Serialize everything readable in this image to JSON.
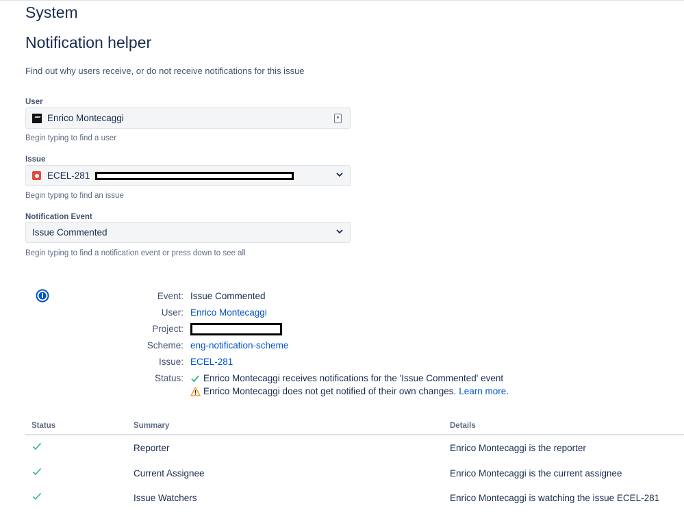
{
  "header": {
    "section_title": "System",
    "page_title": "Notification helper",
    "description": "Find out why users receive, or do not receive notifications for this issue"
  },
  "form": {
    "user": {
      "label": "User",
      "value": "Enrico Montecaggi",
      "hint": "Begin typing to find a user",
      "icon": "user-avatar"
    },
    "issue": {
      "label": "Issue",
      "value": "ECEL-281",
      "hint": "Begin typing to find an issue",
      "icon": "bug-icon"
    },
    "event": {
      "label": "Notification Event",
      "value": "Issue Commented",
      "hint": "Begin typing to find a notification event or press down to see all"
    }
  },
  "result": {
    "icon": "info-icon",
    "rows": [
      {
        "key": "Event:",
        "value": "Issue Commented"
      },
      {
        "key": "User:",
        "value": "Enrico Montecaggi"
      },
      {
        "key": "Project:",
        "value": ""
      },
      {
        "key": "Scheme:",
        "value": "eng-notification-scheme"
      },
      {
        "key": "Issue:",
        "value": "ECEL-281"
      },
      {
        "key": "Status:",
        "value": ""
      }
    ],
    "status_ok": "Enrico Montecaggi receives notifications for the 'Issue Commented' event",
    "status_warn": "Enrico Montecaggi does not get notified of their own changes.",
    "learn_more": "Learn more",
    "period": "."
  },
  "table": {
    "headers": {
      "status": "Status",
      "summary": "Summary",
      "details": "Details"
    },
    "rows": [
      {
        "summary": "Reporter",
        "details": "Enrico Montecaggi is the reporter"
      },
      {
        "summary": "Current Assignee",
        "details": "Enrico Montecaggi is the current assignee"
      },
      {
        "summary": "Issue Watchers",
        "details": "Enrico Montecaggi is watching the issue ECEL-281"
      }
    ]
  },
  "colors": {
    "link": "#0052cc",
    "success": "#36b37e",
    "warning": "#ff991f",
    "info": "#0052cc",
    "bug": "#e5493a"
  }
}
